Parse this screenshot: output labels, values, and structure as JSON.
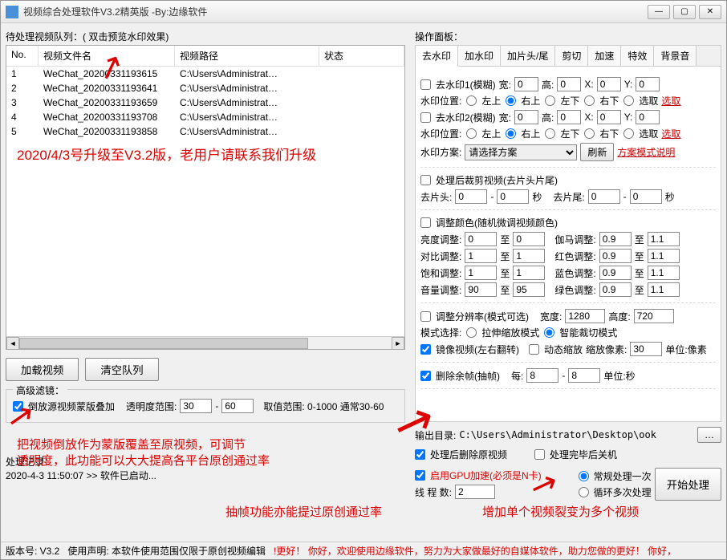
{
  "window": {
    "title": "视频综合处理软件V3.2精英版 -By:边缘软件"
  },
  "left": {
    "queueLabel": "待处理视频队列：( 双击预览水印效果)",
    "cols": {
      "no": "No.",
      "name": "视频文件名",
      "path": "视频路径",
      "status": "状态"
    },
    "rows": [
      {
        "no": "1",
        "name": "WeChat_20200331193615",
        "path": "C:\\Users\\Administrat…",
        "status": ""
      },
      {
        "no": "2",
        "name": "WeChat_20200331193641",
        "path": "C:\\Users\\Administrat…",
        "status": ""
      },
      {
        "no": "3",
        "name": "WeChat_20200331193659",
        "path": "C:\\Users\\Administrat…",
        "status": ""
      },
      {
        "no": "4",
        "name": "WeChat_20200331193708",
        "path": "C:\\Users\\Administrat…",
        "status": ""
      },
      {
        "no": "5",
        "name": "WeChat_20200331193858",
        "path": "C:\\Users\\Administrat…",
        "status": ""
      }
    ],
    "loadBtn": "加载视频",
    "clearBtn": "清空队列",
    "advGroup": "高级滤镜：",
    "reverseChk": "倒放源视频蒙版叠加",
    "opacityLabel": "透明度范围:",
    "opacity": {
      "min": "30",
      "max": "60"
    },
    "opacityHint": "取值范围: 0-1000 通常30-60",
    "logLabel": "处理记录：",
    "logLine": "2020-4-3 11:50:07 >> 软件已启动..."
  },
  "right": {
    "panelLabel": "操作面板：",
    "tabs": [
      "去水印",
      "加水印",
      "加片头/尾",
      "剪切",
      "加速",
      "特效",
      "背景音"
    ],
    "wm": {
      "wm1": "去水印1(模糊)",
      "wm2": "去水印2(模糊)",
      "wLabel": "宽:",
      "hLabel": "高:",
      "xLabel": "X:",
      "yLabel": "Y:",
      "w": "0",
      "h": "0",
      "x": "0",
      "y": "0",
      "posLabel": "水印位置:",
      "posOpts": [
        "左上",
        "右上",
        "左下",
        "右下",
        "选取"
      ],
      "selectBtn": "选取",
      "schemeLabel": "水印方案:",
      "schemeSel": "请选择方案",
      "refreshBtn": "刷新",
      "schemeHelp": "方案模式说明"
    },
    "trim": {
      "chk": "处理后裁剪视频(去片头片尾)",
      "headLabel": "去片头:",
      "tailLabel": "去片尾:",
      "head1": "0",
      "head2": "0",
      "tail1": "0",
      "tail2": "0",
      "sec": "秒"
    },
    "color": {
      "chk": "调整颜色(随机微调视频颜色)",
      "bright": "亮度调整:",
      "brightTo": "至",
      "contrast": "对比调整:",
      "sat": "饱和调整:",
      "vol": "音量调整:",
      "gamma": "伽马调整:",
      "red": "红色调整:",
      "blue": "蓝色调整:",
      "green": "绿色调整:",
      "v": {
        "b1": "0",
        "b2": "0",
        "c1": "1",
        "c2": "1",
        "s1": "1",
        "s2": "1",
        "v1": "90",
        "v2": "95",
        "g1": "0.9",
        "g2": "1.1",
        "r1": "0.9",
        "r2": "1.1",
        "bl1": "0.9",
        "bl2": "1.1",
        "gr1": "0.9",
        "gr2": "1.1"
      }
    },
    "res": {
      "chk": "调整分辨率(模式可选)",
      "wLabel": "宽度:",
      "hLabel": "高度:",
      "w": "1280",
      "h": "720",
      "modeLabel": "模式选择:",
      "mode1": "拉伸缩放模式",
      "mode2": "智能裁切模式"
    },
    "mirror": {
      "chk": "镜像视频(左右翻转)",
      "dynChk": "动态缩放",
      "pxLabel": "缩放像素:",
      "px": "30",
      "unit": "单位:像素"
    },
    "frame": {
      "chk": "删除余帧(抽帧)",
      "everyLabel": "每:",
      "v1": "8",
      "v2": "8",
      "unit": "单位:秒"
    },
    "out": {
      "label": "输出目录:",
      "path": "C:\\Users\\Administrator\\Desktop\\ook",
      "browse": "…"
    },
    "post": {
      "delChk": "处理后删除原视频",
      "shutChk": "处理完毕后关机",
      "gpuChk": "启用GPU加速(必须是N卡)",
      "threadLabel": "线 程 数:",
      "threads": "2",
      "mode1": "常规处理一次",
      "mode2": "循环多次处理",
      "startBtn": "开始处理"
    }
  },
  "ann": {
    "a1": "2020/4/3号升级至V3.2版，老用户请联系我们升级",
    "a2a": "把视频倒放作为蒙版覆盖至原视频，可调节",
    "a2b": "透明度，此功能可以大大提高各平台原创通过率",
    "a3": "抽帧功能亦能提过原创通过率",
    "a4": "增加单个视频裂变为多个视频"
  },
  "status": {
    "ver": "版本号: V3.2",
    "decl": "使用声明: 本软件使用范围仅限于原创视频编辑",
    "warn": "!更好！ 你好，欢迎使用边缘软件，努力为大家做最好的自媒体软件，助力您做的更好！ 你好，"
  }
}
